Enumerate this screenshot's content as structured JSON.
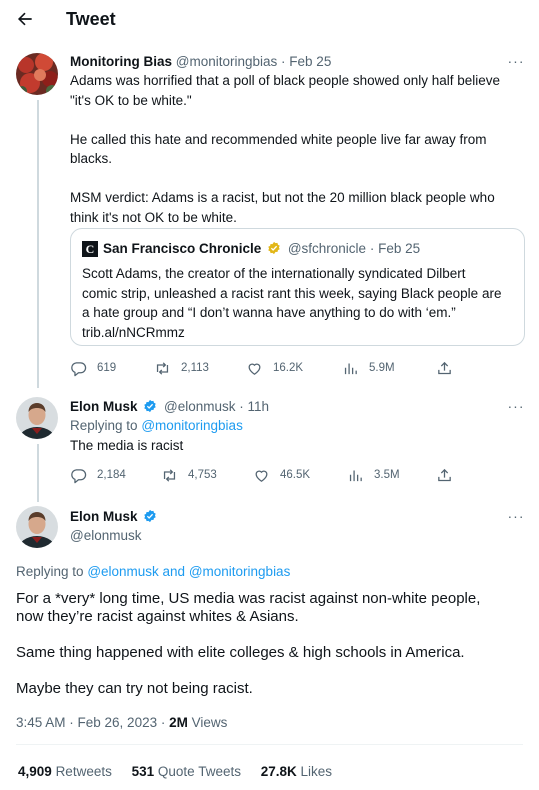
{
  "header": {
    "title": "Tweet",
    "back_icon": "arrow-left-icon"
  },
  "colors": {
    "link": "#1d9bf0",
    "secondary": "#536471",
    "border": "#cfd9de",
    "verified_blue": "#1d9bf0",
    "verified_gold": "#e2b719"
  },
  "tweet1": {
    "name": "Monitoring Bias",
    "handle": "@monitoringbias",
    "date": "· Feb 25",
    "paragraphs": [
      "Adams was horrified that a poll of black people showed only half believe\n\"it's OK to be white.\"",
      "He called this hate and recommended white people live far away from\nblacks.",
      "MSM verdict: Adams is a racist, but not the 20 million black people who\nthink it's not OK to be white."
    ],
    "quote": {
      "name": "San Francisco Chronicle",
      "handle": "@sfchronicle",
      "date": "· Feb 25",
      "logo_letter": "C",
      "text": "Scott Adams, the creator of the internationally syndicated Dilbert\ncomic strip, unleashed a racist rant this week, saying Black people are\na hate group and “I don’t wanna have anything to do with ‘em.”\ntrib.al/nNCRmmz"
    },
    "actions": {
      "replies": "619",
      "retweets": "2,113",
      "likes": "16.2K",
      "views": "5.9M"
    }
  },
  "tweet2": {
    "name": "Elon Musk",
    "handle": "@elonmusk",
    "date": "· 11h",
    "replying_prefix": "Replying to",
    "replying_to": "@monitoringbias",
    "text": "The media is racist",
    "actions": {
      "replies": "2,184",
      "retweets": "4,753",
      "likes": "46.5K",
      "views": "3.5M"
    }
  },
  "main_tweet": {
    "name": "Elon Musk",
    "handle": "@elonmusk",
    "replying_prefix": "Replying to",
    "replying_to": "@elonmusk and @monitoringbias",
    "paragraphs": [
      "For a *very* long time, US media was racist against non-white people,\nnow they’re racist against whites & Asians.",
      "Same thing happened with elite colleges & high schools in America.",
      "Maybe they can try not being racist."
    ],
    "time": "3:45 AM · Feb 26, 2023 · ",
    "views_count": "2M",
    "views_label": "Views",
    "stats": {
      "retweets_count": "4,909",
      "retweets_label": "Retweets",
      "quotes_count": "531",
      "quotes_label": "Quote Tweets",
      "likes_count": "27.8K",
      "likes_label": "Likes"
    }
  }
}
